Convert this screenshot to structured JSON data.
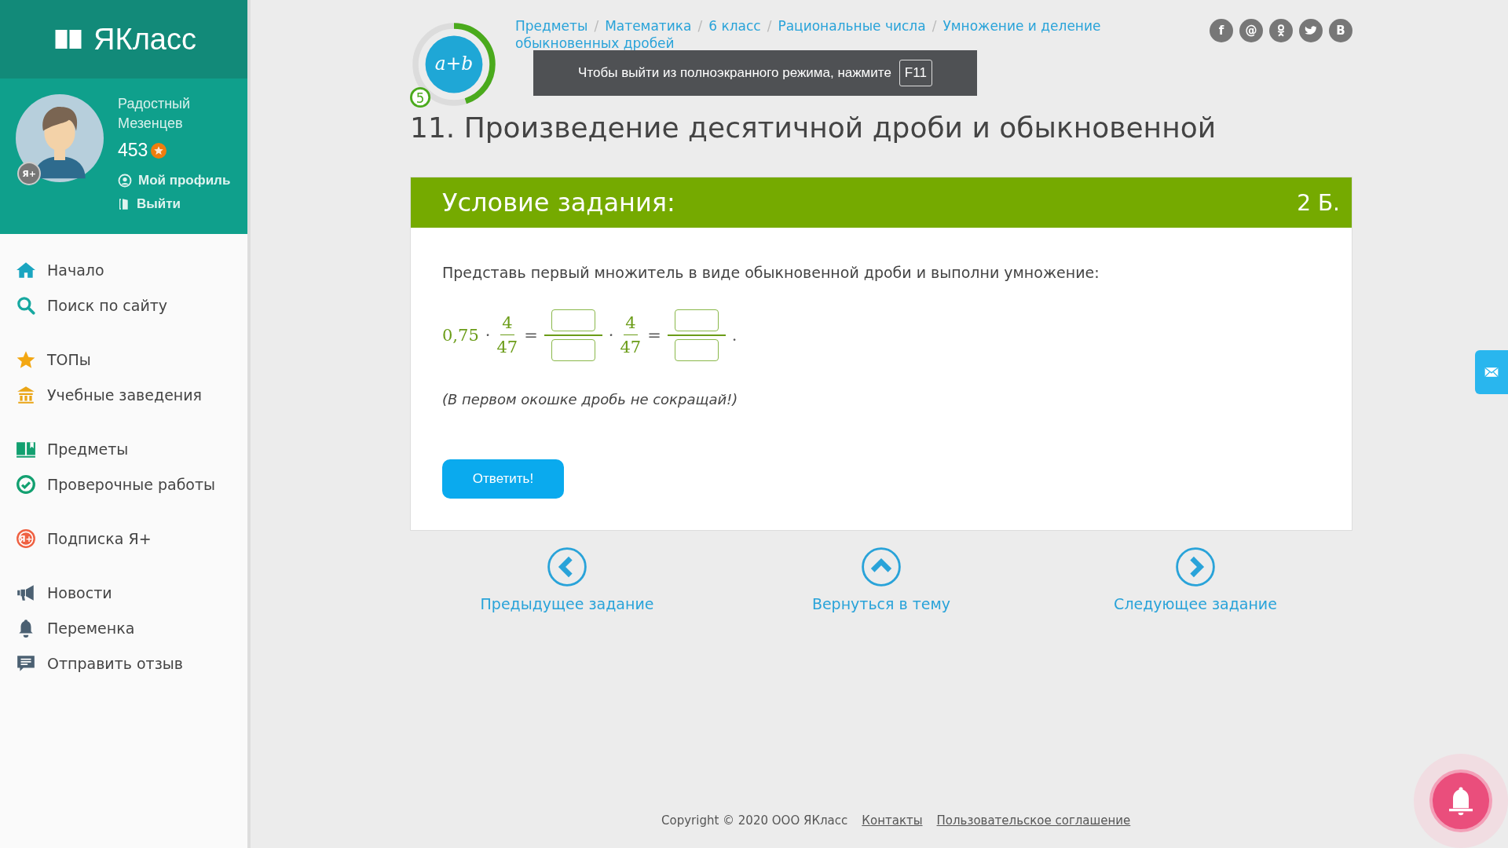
{
  "sidebar": {
    "logo": "ЯКласс",
    "user": {
      "name": "Радостный Мезенцев",
      "points": "453",
      "badge": "Я+",
      "links": [
        {
          "kind": "profile",
          "label": "Мой профиль"
        },
        {
          "kind": "logout",
          "label": "Выйти"
        }
      ]
    },
    "groups": [
      [
        {
          "kind": "home",
          "label": "Начало"
        },
        {
          "kind": "search",
          "label": "Поиск по сайту"
        }
      ],
      [
        {
          "kind": "star",
          "label": "ТОПы"
        },
        {
          "kind": "school",
          "label": "Учебные заведения"
        }
      ],
      [
        {
          "kind": "book",
          "label": "Предметы"
        },
        {
          "kind": "check",
          "label": "Проверочные работы"
        }
      ],
      [
        {
          "kind": "plus",
          "label": "Подписка Я+",
          "badge": "Я+"
        }
      ],
      [
        {
          "kind": "news",
          "label": "Новости"
        },
        {
          "kind": "bell",
          "label": "Переменка"
        },
        {
          "kind": "feedback",
          "label": "Отправить отзыв"
        }
      ]
    ]
  },
  "topic_badge": {
    "text": "a+b",
    "level": 0.45,
    "count": "5"
  },
  "breadcrumbs": {
    "separator": "/",
    "items": [
      {
        "lines": [
          "Предметы"
        ]
      },
      {
        "lines": [
          "Математика"
        ]
      },
      {
        "lines": [
          "6 класс"
        ]
      },
      {
        "lines": [
          "Рациональные числа"
        ]
      },
      {
        "lines": [
          "Умножение и деление",
          "обыкновенных дробей"
        ]
      }
    ]
  },
  "social": [
    {
      "kind": "text",
      "text": "f"
    },
    {
      "kind": "text",
      "text": "@"
    },
    {
      "kind": "odnoklassniki"
    },
    {
      "kind": "twitter"
    },
    {
      "kind": "text",
      "text": "B"
    }
  ],
  "fullscreen_notice": {
    "text": "Чтобы выйти из полноэкранного режима, нажмите",
    "key": "F11"
  },
  "title": "11. Произведение десятичной дроби и обыкновенной",
  "task": {
    "header": "Условие задания:",
    "points": "2 Б.",
    "instruction": "Представь первый множитель в виде обыкновенной дроби и выполни умножение:",
    "equation": [
      {
        "kind": "number",
        "text": "0,75"
      },
      {
        "kind": "op",
        "text": "·"
      },
      {
        "kind": "fraction",
        "num": "4",
        "den": "47"
      },
      {
        "kind": "op",
        "text": "="
      },
      {
        "kind": "input_fraction"
      },
      {
        "kind": "op",
        "text": "·"
      },
      {
        "kind": "fraction",
        "num": "4",
        "den": "47"
      },
      {
        "kind": "op",
        "text": "="
      },
      {
        "kind": "input_fraction"
      },
      {
        "kind": "op",
        "text": "."
      }
    ],
    "note": "(В первом окошке дробь не сокращай!)",
    "button": "Ответить!"
  },
  "navigation": [
    {
      "kind": "prev",
      "label": "Предыдущее задание"
    },
    {
      "kind": "up",
      "label": "Вернуться в тему"
    },
    {
      "kind": "next",
      "label": "Следующее задание"
    }
  ],
  "footer": {
    "copyright": "Copyright © 2020 ООО ЯКласс",
    "links": [
      "Контакты",
      "Пользовательское соглашение"
    ]
  }
}
